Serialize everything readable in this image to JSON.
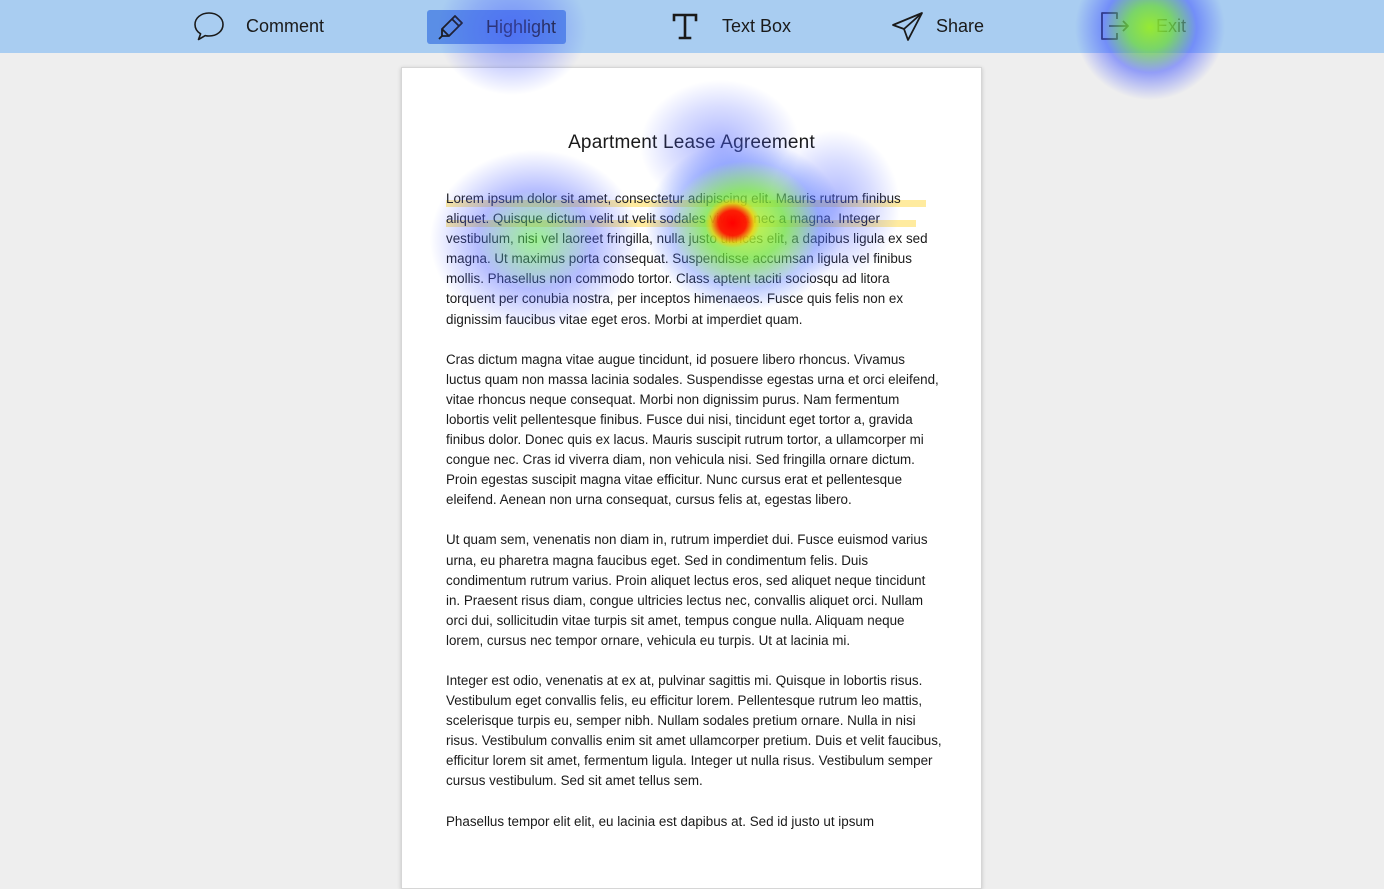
{
  "toolbar": {
    "comment": {
      "label": "Comment",
      "icon": "speech-bubble-icon"
    },
    "highlight": {
      "label": "Highlight",
      "icon": "marker-pen-icon",
      "active": true
    },
    "textbox": {
      "label": "Text Box",
      "icon": "text-t-icon"
    },
    "share": {
      "label": "Share",
      "icon": "paper-plane-icon"
    },
    "exit": {
      "label": "Exit",
      "icon": "exit-door-icon"
    }
  },
  "document": {
    "title": "Apartment Lease Agreement",
    "paragraphs": [
      "Lorem ipsum dolor sit amet, consectetur adipiscing elit. Mauris rutrum finibus aliquet. Quisque dictum velit ut velit sodales viverra nec a magna. Integer vestibulum, nisi vel laoreet fringilla, nulla justo ultrices elit, a dapibus ligula ex sed magna. Ut maximus porta consequat. Suspendisse accumsan ligula vel finibus mollis. Phasellus non commodo tortor. Class aptent taciti sociosqu ad litora torquent per conubia nostra, per inceptos himenaeos. Fusce quis felis non ex dignissim faucibus vitae eget eros. Morbi at imperdiet quam.",
      "Cras dictum magna vitae augue tincidunt, id posuere libero rhoncus. Vivamus luctus quam non massa lacinia sodales. Suspendisse egestas urna et orci eleifend, vitae rhoncus neque consequat. Morbi non dignissim purus. Nam fermentum lobortis velit pellentesque finibus. Fusce dui nisi, tincidunt eget tortor a, gravida finibus dolor. Donec quis ex lacus. Mauris suscipit rutrum tortor, a ullamcorper mi congue nec. Cras id viverra diam, non vehicula nisi. Sed fringilla ornare dictum. Proin egestas suscipit magna vitae efficitur. Nunc cursus erat et pellentesque eleifend. Aenean non urna consequat, cursus felis at, egestas libero.",
      "Ut quam sem, venenatis non diam in, rutrum imperdiet dui. Fusce euismod varius urna, eu pharetra magna faucibus eget. Sed in condimentum felis. Duis condimentum rutrum varius. Proin aliquet lectus eros, sed aliquet neque tincidunt in. Praesent risus diam, congue ultricies lectus nec, convallis aliquet orci. Nullam orci dui, sollicitudin vitae turpis sit amet, tempus congue nulla. Aliquam neque lorem, cursus nec tempor ornare, vehicula eu turpis. Ut at lacinia mi.",
      "Integer est odio, venenatis at ex at, pulvinar sagittis mi. Quisque in lobortis risus. Vestibulum eget convallis felis, eu efficitur lorem. Pellentesque rutrum leo mattis, scelerisque turpis eu, semper nibh. Nullam sodales pretium ornare. Nulla in nisi risus. Vestibulum convallis enim sit amet ullamcorper pretium. Duis et velit faucibus, efficitur lorem sit amet, fermentum ligula. Integer ut nulla risus. Vestibulum semper cursus vestibulum. Sed sit amet tellus sem.",
      "Phasellus tempor elit elit, eu lacinia est dapibus at. Sed id justo ut ipsum"
    ]
  },
  "colors": {
    "toolbar_bg": "#a9cdf1",
    "active_tool_bg": "#5a8ee6",
    "highlight_marker": "#ffda50",
    "page_bg": "#ffffff",
    "canvas_bg": "#eeeeee"
  }
}
